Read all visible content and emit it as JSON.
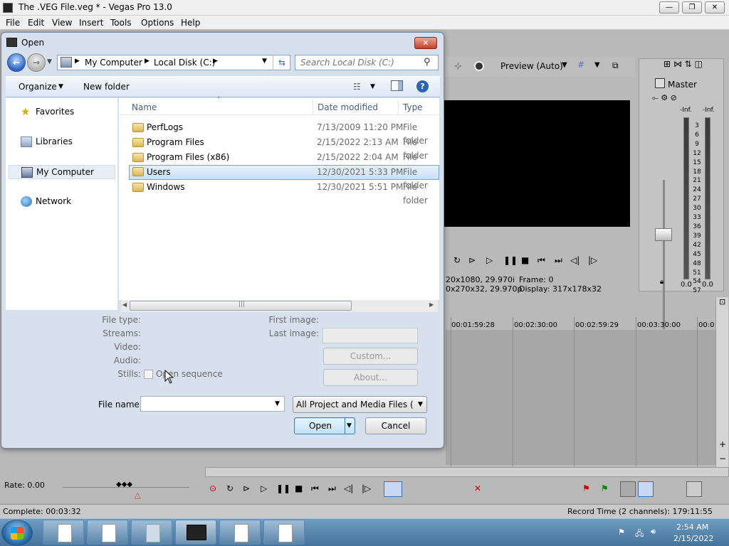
{
  "app": {
    "title": "The .VEG File.veg * - Vegas Pro 13.0",
    "menu": [
      "File",
      "Edit",
      "View",
      "Insert",
      "Tools",
      "Options",
      "Help"
    ],
    "preview": {
      "quality": "Preview (Auto)",
      "info_line1_left": "20x1080, 29.970i",
      "info_line1_right": "Frame:   0",
      "info_line2_left": "0x270x32, 29.970p",
      "info_line2_right": "Display:   317x178x32"
    },
    "master": {
      "label": "Master",
      "inf_left": "-Inf.",
      "inf_right": "-Inf.",
      "scale": [
        "3",
        "6",
        "9",
        "12",
        "15",
        "18",
        "21",
        "24",
        "27",
        "30",
        "33",
        "36",
        "39",
        "42",
        "45",
        "48",
        "51",
        "54",
        "57"
      ],
      "bottom_left": "0.0",
      "bottom_right": "0.0"
    },
    "timeline_ticks": [
      "00:01:59:28",
      "00:02:30:00",
      "00:02:59:29",
      "00:03:30:00",
      "00:0"
    ],
    "rate": "Rate: 0.00",
    "status_left": "Complete: 00:03:32",
    "status_right": "Record Time (2 channels): 179:11:55"
  },
  "dialog": {
    "title": "Open",
    "breadcrumb": [
      "My Computer",
      "Local Disk (C:)"
    ],
    "search_placeholder": "Search Local Disk (C:)",
    "organize": "Organize",
    "new_folder": "New folder",
    "nav_items": [
      "Favorites",
      "Libraries",
      "My Computer",
      "Network"
    ],
    "columns": {
      "name": "Name",
      "date": "Date modified",
      "type": "Type"
    },
    "rows": [
      {
        "name": "PerfLogs",
        "date": "7/13/2009 11:20 PM",
        "type": "File folder"
      },
      {
        "name": "Program Files",
        "date": "2/15/2022 2:13 AM",
        "type": "File folder"
      },
      {
        "name": "Program Files (x86)",
        "date": "2/15/2022 2:04 AM",
        "type": "File folder"
      },
      {
        "name": "Users",
        "date": "12/30/2021 5:33 PM",
        "type": "File folder"
      },
      {
        "name": "Windows",
        "date": "12/30/2021 5:51 PM",
        "type": "File folder"
      }
    ],
    "info_labels": {
      "file_type": "File type:",
      "streams": "Streams:",
      "video": "Video:",
      "audio": "Audio:",
      "stills": "Stills:",
      "first_image": "First image:",
      "last_image": "Last image:"
    },
    "open_sequence": "Open sequence",
    "custom_button": "Custom...",
    "about_button": "About...",
    "file_name_label": "File name:",
    "file_name_value": "",
    "file_type_filter": "All Project and Media Files (*.ve",
    "open_button": "Open",
    "cancel_button": "Cancel"
  },
  "taskbar": {
    "time": "2:54 AM",
    "date": "2/15/2022"
  }
}
